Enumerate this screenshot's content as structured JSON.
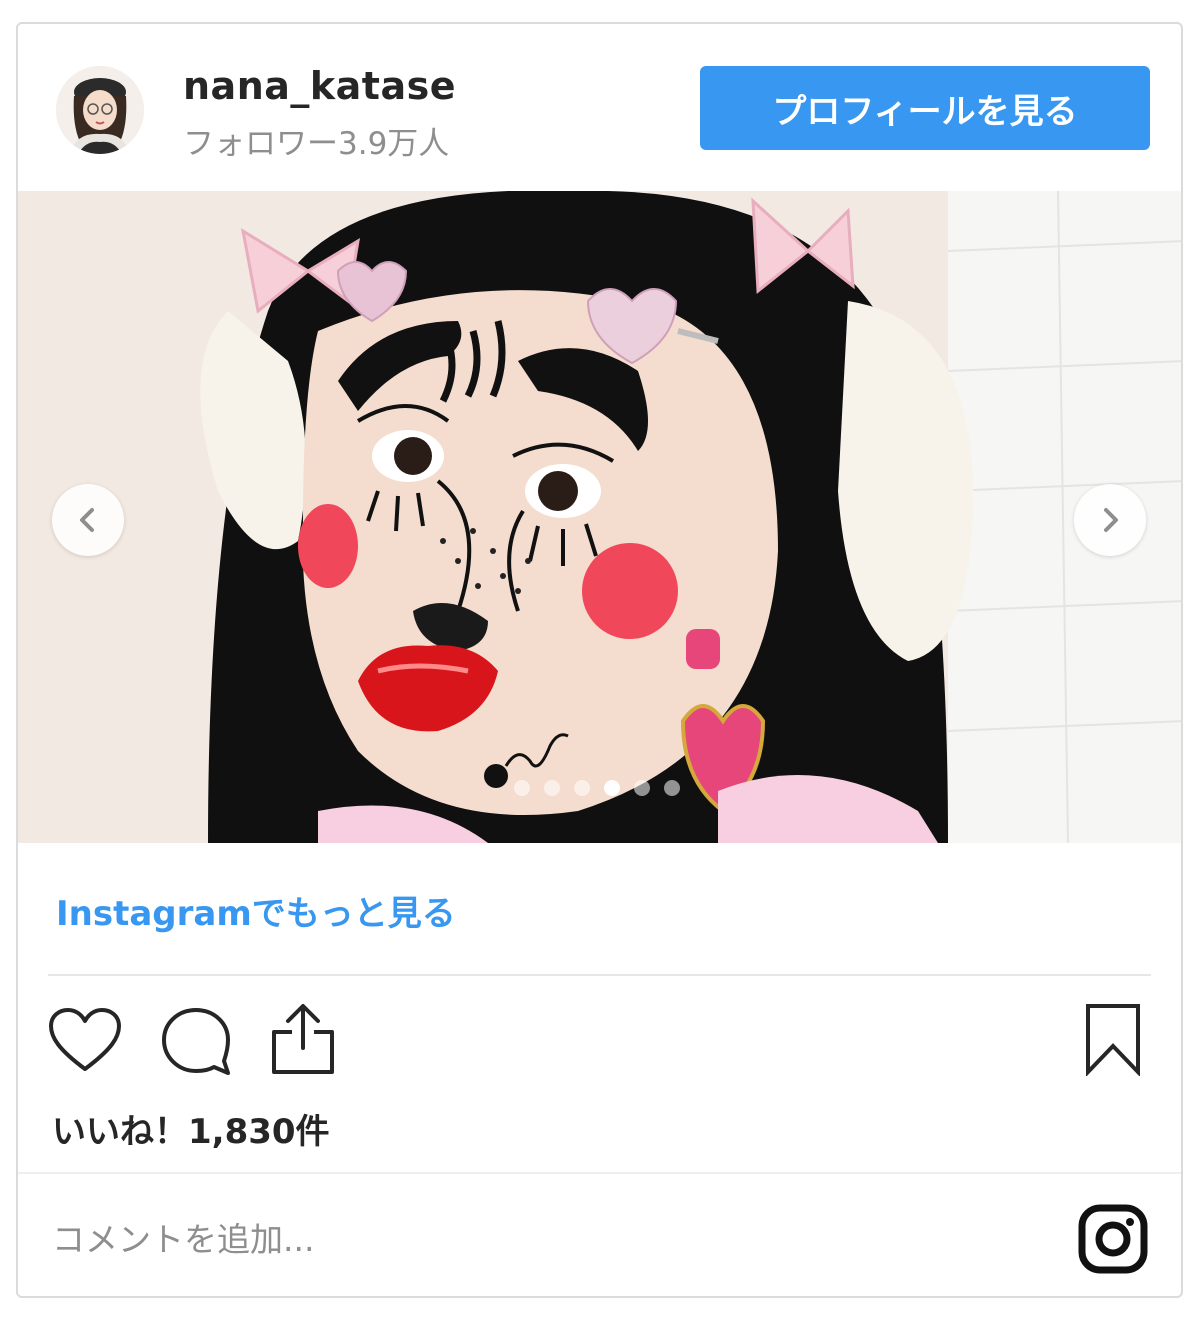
{
  "header": {
    "username": "nana_katase",
    "followers": "フォロワー3.9万人",
    "profile_button": "プロフィールを見る"
  },
  "carousel": {
    "total_slides": 6,
    "active_slide": 4
  },
  "more_link": "Instagramでもっと見る",
  "likes": "いいね！1,830件",
  "comment": {
    "placeholder": "コメントを追加..."
  },
  "colors": {
    "accent": "#3897f0",
    "text": "#262626",
    "muted": "#8e8e8e",
    "border": "#dbdbdb"
  },
  "icons": [
    "heart-icon",
    "comment-icon",
    "share-icon",
    "bookmark-icon",
    "instagram-logo-icon",
    "chevron-left-icon",
    "chevron-right-icon"
  ]
}
